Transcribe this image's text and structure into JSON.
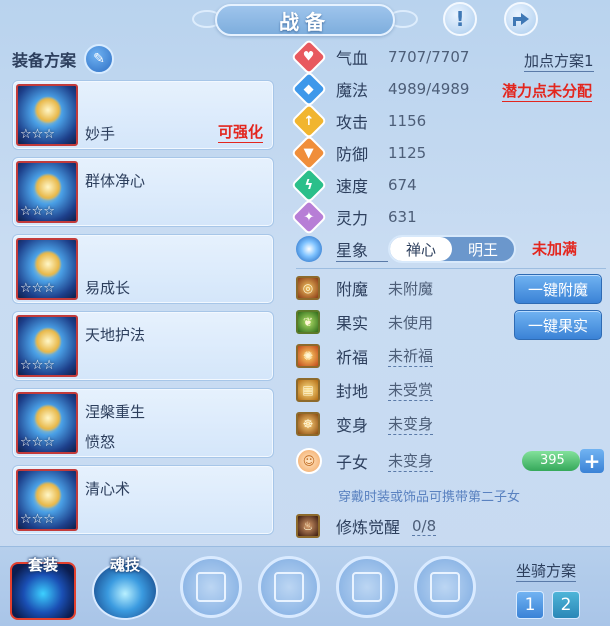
{
  "title": "战备",
  "header": {
    "info_icon": "info-icon",
    "share_icon": "share-icon"
  },
  "left": {
    "label": "装备方案",
    "skills": [
      {
        "name": "妙手",
        "tag": "可强化",
        "stars": "☆☆☆"
      },
      {
        "name": "群体净心",
        "tag": "",
        "stars": "☆☆☆"
      },
      {
        "name": "易成长",
        "tag": "",
        "stars": "☆☆☆"
      },
      {
        "name": "天地护法",
        "tag": "",
        "stars": "☆☆☆"
      },
      {
        "name": "涅槃重生",
        "sub": "愤怒",
        "tag": "",
        "stars": "☆☆☆"
      },
      {
        "name": "清心术",
        "tag": "",
        "stars": "☆☆☆"
      }
    ]
  },
  "stats": {
    "hp": {
      "label": "气血",
      "value": "7707/7707",
      "icon_color": "#e8595f"
    },
    "mp": {
      "label": "魔法",
      "value": "4989/4989",
      "icon_color": "#3e98ea"
    },
    "atk": {
      "label": "攻击",
      "value": "1156",
      "icon_color": "#f1b52f"
    },
    "def": {
      "label": "防御",
      "value": "1125",
      "icon_color": "#f08e3a"
    },
    "spd": {
      "label": "速度",
      "value": "674",
      "icon_color": "#2bbf8a"
    },
    "spi": {
      "label": "灵力",
      "value": "631",
      "icon_color": "#b77ed6"
    },
    "plan_link": "加点方案1",
    "warn_points": "潜力点未分配"
  },
  "star": {
    "label": "星象",
    "opt1": "禅心",
    "opt2": "明王",
    "warn": "未加满"
  },
  "extras": {
    "enchant": {
      "label": "附魔",
      "value": "未附魔",
      "button": "一键附魔"
    },
    "fruit": {
      "label": "果实",
      "value": "未使用",
      "button": "一键果实"
    },
    "bless": {
      "label": "祈福",
      "value": "未祈福"
    },
    "fief": {
      "label": "封地",
      "value": "未受赏"
    },
    "transform": {
      "label": "变身",
      "value": "未变身"
    },
    "child": {
      "label": "子女",
      "value": "未变身",
      "count": "395"
    },
    "hint": "穿戴时装或饰品可携带第二子女",
    "cultivate": {
      "label": "修炼觉醒",
      "value": "0/8"
    }
  },
  "bottom": {
    "tab1": "套装",
    "tab2": "魂技",
    "mount_label": "坐骑方案",
    "mount1": "1",
    "mount2": "2"
  }
}
